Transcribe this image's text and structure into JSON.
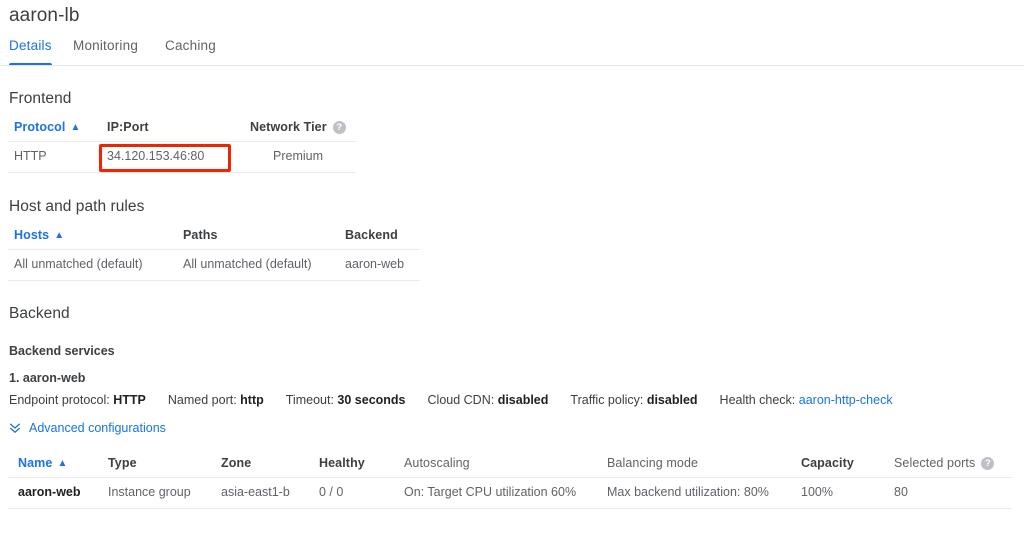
{
  "header": {
    "title": "aaron-lb",
    "tabs": [
      {
        "label": "Details",
        "active": true
      },
      {
        "label": "Monitoring",
        "active": false
      },
      {
        "label": "Caching",
        "active": false
      }
    ]
  },
  "frontend": {
    "section_title": "Frontend",
    "columns": [
      "Protocol",
      "IP:Port",
      "Network Tier"
    ],
    "sort_column": "Protocol",
    "sort_direction": "asc",
    "help_icon": "help-circle-icon",
    "rows": [
      {
        "protocol": "HTTP",
        "ip_port": "34.120.153.46:80",
        "network_tier": "Premium"
      }
    ],
    "highlight": {
      "target": "ip_port",
      "color": "#f22400"
    }
  },
  "host_path_rules": {
    "section_title": "Host and path rules",
    "columns": [
      "Hosts",
      "Paths",
      "Backend"
    ],
    "sort_column": "Hosts",
    "sort_direction": "asc",
    "rows": [
      {
        "hosts": "All unmatched (default)",
        "paths": "All unmatched (default)",
        "backend": "aaron-web"
      }
    ]
  },
  "backend": {
    "section_title": "Backend",
    "services_title": "Backend services",
    "service_name": "1. aaron-web",
    "info": [
      {
        "label": "Endpoint protocol:",
        "value": "HTTP",
        "link": false
      },
      {
        "label": "Named port:",
        "value": "http",
        "link": false
      },
      {
        "label": "Timeout:",
        "value": "30 seconds",
        "link": false
      },
      {
        "label": "Cloud CDN:",
        "value": "disabled",
        "link": false
      },
      {
        "label": "Traffic policy:",
        "value": "disabled",
        "link": false
      },
      {
        "label": "Health check:",
        "value": "aaron-http-check",
        "link": true
      }
    ],
    "advanced_link": "Advanced configurations",
    "advanced_icon": "double-chevron-down-icon",
    "table": {
      "columns": [
        {
          "label": "Name",
          "style": "sortable"
        },
        {
          "label": "Type",
          "style": "bold"
        },
        {
          "label": "Zone",
          "style": "bold"
        },
        {
          "label": "Healthy",
          "style": "bold"
        },
        {
          "label": "Autoscaling",
          "style": "muted"
        },
        {
          "label": "Balancing mode",
          "style": "muted"
        },
        {
          "label": "Capacity",
          "style": "bold"
        },
        {
          "label": "Selected ports",
          "style": "muted",
          "help": true
        }
      ],
      "sort_column": "Name",
      "sort_direction": "asc",
      "rows": [
        {
          "name": "aaron-web",
          "type": "Instance group",
          "zone": "asia-east1-b",
          "healthy": "0 / 0",
          "autoscaling": "On: Target CPU utilization 60%",
          "balancing_mode": "Max backend utilization: 80%",
          "capacity": "100%",
          "selected_ports": "80"
        }
      ]
    }
  },
  "colors": {
    "accent": "#1a73e8",
    "text": "#3c4043",
    "muted": "#5f6368",
    "divider": "#e8eaed",
    "highlight": "#f22400"
  }
}
